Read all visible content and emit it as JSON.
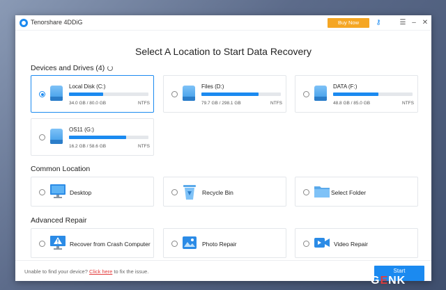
{
  "app": {
    "title": "Tenorshare 4DDiG",
    "buy_label": "Buy Now",
    "icons": [
      "key-icon",
      "menu-icon",
      "minimize-icon",
      "close-icon"
    ]
  },
  "main": {
    "heading": "Select A Location to Start Data Recovery"
  },
  "devices": {
    "title": "Devices and Drives (4)",
    "drives": [
      {
        "name": "Local Disk (C:)",
        "size": "34.0 GB / 80.0 GB",
        "fs": "NTFS",
        "used_fraction": 0.43,
        "selected": true
      },
      {
        "name": "Files (D:)",
        "size": "79.7 GB / 298.1 GB",
        "fs": "NTFS",
        "used_fraction": 0.72,
        "selected": false
      },
      {
        "name": "DATA (F:)",
        "size": "48.8 GB / 85.0 GB",
        "fs": "NTFS",
        "used_fraction": 0.57,
        "selected": false
      },
      {
        "name": "OS11 (G:)",
        "size": "16.2 GB / 58.6 GB",
        "fs": "NTFS",
        "used_fraction": 0.72,
        "selected": false
      }
    ]
  },
  "common": {
    "title": "Common Location",
    "items": [
      {
        "label": "Desktop",
        "icon": "monitor-icon"
      },
      {
        "label": "Recycle Bin",
        "icon": "recycle-bin-icon"
      },
      {
        "label": "Select Folder",
        "icon": "folder-icon"
      }
    ]
  },
  "repair": {
    "title": "Advanced Repair",
    "items": [
      {
        "label": "Recover from Crash Computer",
        "icon": "crash-computer-icon"
      },
      {
        "label": "Photo Repair",
        "icon": "photo-icon"
      },
      {
        "label": "Video Repair",
        "icon": "video-icon"
      }
    ]
  },
  "footer": {
    "text_before": "Unable to find your device? ",
    "link": "Click here",
    "text_after": " to fix the issue.",
    "start_label": "Start"
  },
  "watermark": {
    "text_g": "G",
    "text_e": "E",
    "text_nk": "NK"
  },
  "colors": {
    "accent": "#1b8af0",
    "buy": "#f5a623",
    "link": "#e23b3b"
  }
}
